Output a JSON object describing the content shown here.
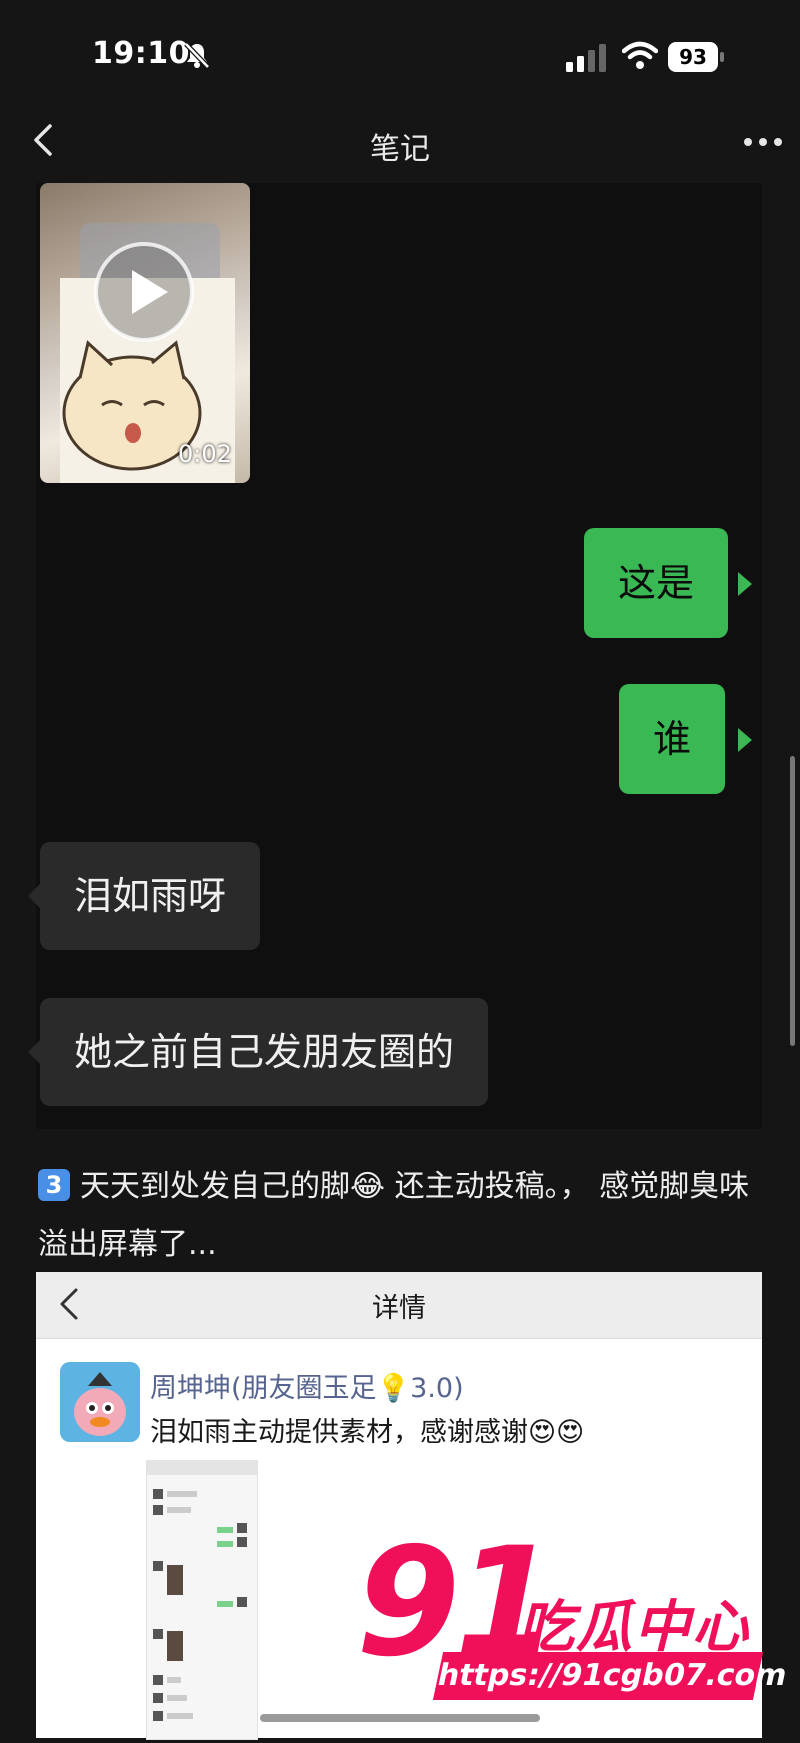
{
  "status_bar": {
    "time": "19:10",
    "battery": "93"
  },
  "nav": {
    "title": "笔记"
  },
  "chat": {
    "video_duration": "0:02",
    "messages": [
      {
        "side": "right",
        "text": "这是"
      },
      {
        "side": "right",
        "text": "谁"
      },
      {
        "side": "left",
        "text": "泪如雨呀"
      },
      {
        "side": "left",
        "text": "她之前自己发朋友圈的"
      }
    ]
  },
  "caption": {
    "badge": "3",
    "text": "天天到处发自己的脚😂 还主动投稿。， 感觉脚臭味溢出屏幕了..."
  },
  "screenshot2": {
    "title": "详情",
    "poster_name": "周坤坤(朋友圈玉足💡3.0)",
    "post_text": "泪如雨主动提供素材，感谢感谢😍😍"
  },
  "watermark": {
    "number": "91",
    "name": "吃瓜中心",
    "url": "https://91cgb07.com"
  }
}
